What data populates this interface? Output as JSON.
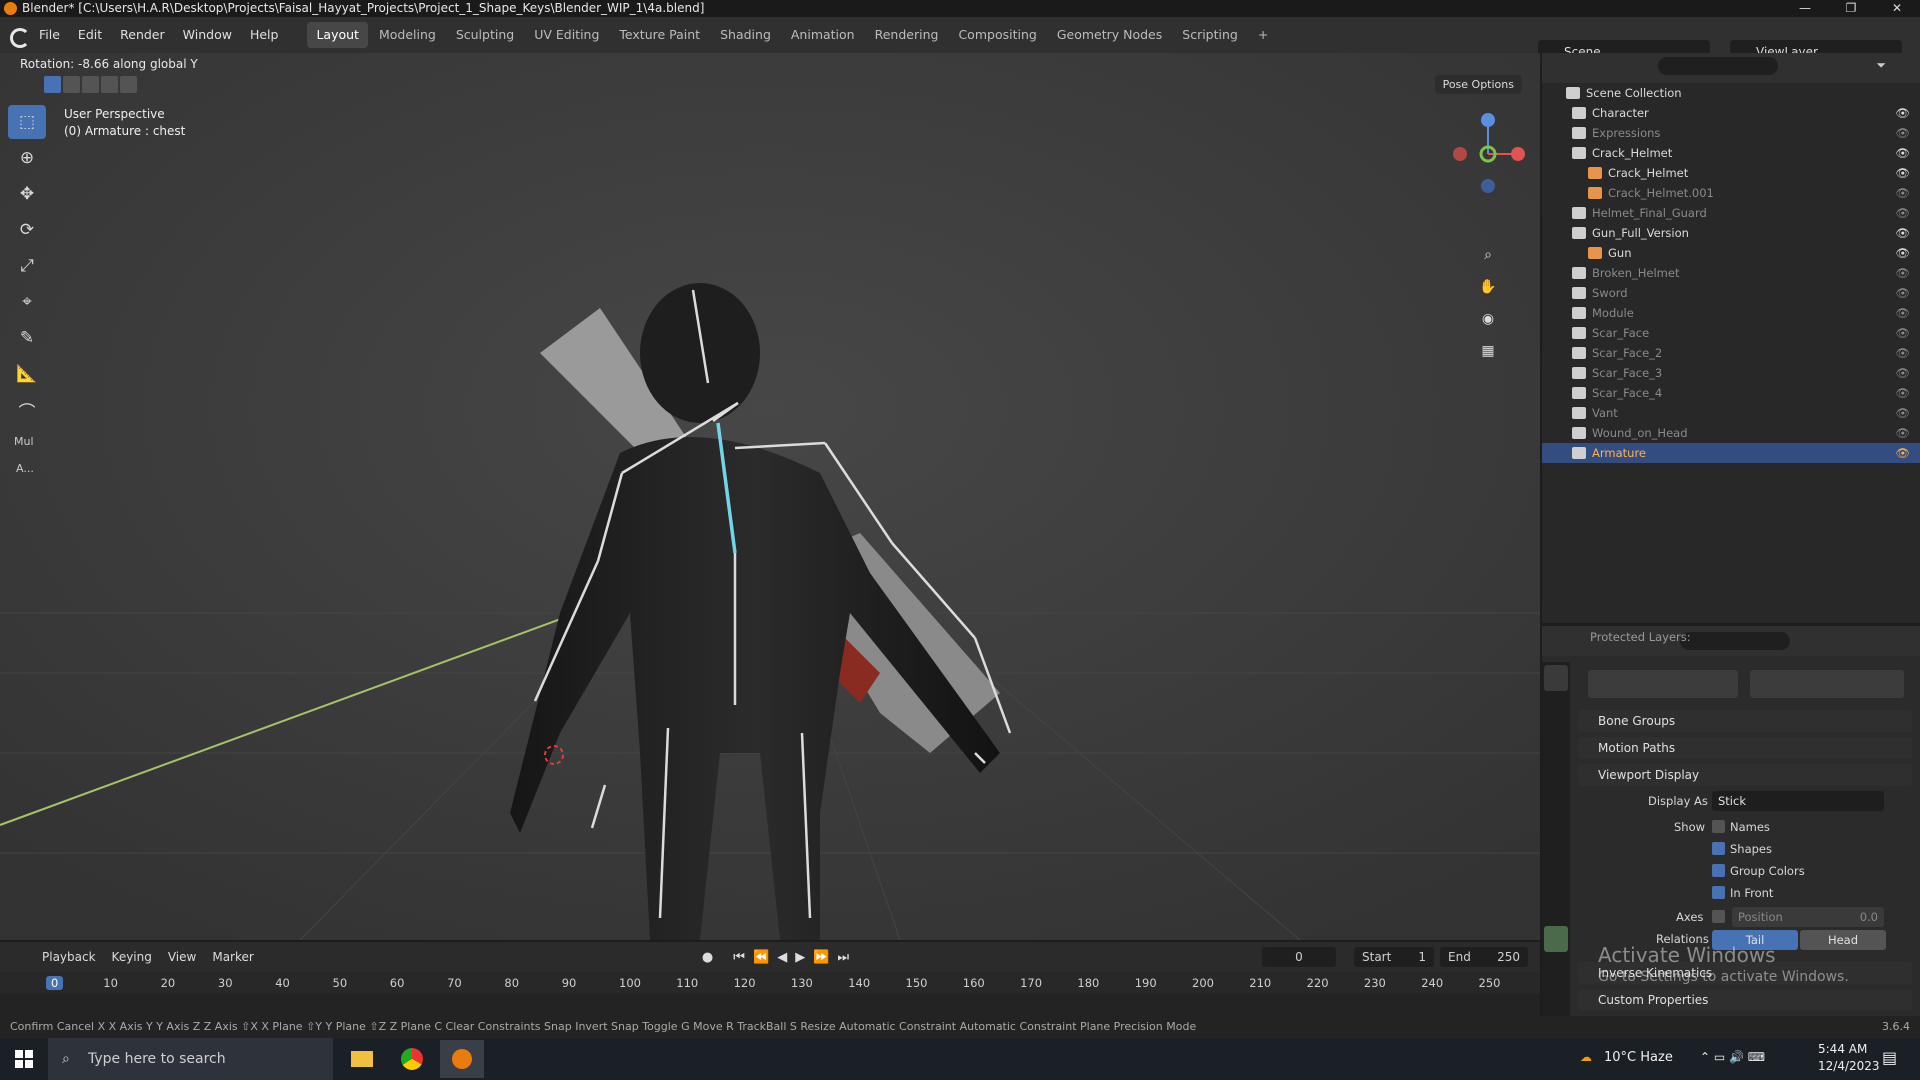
{
  "window": {
    "title": "Blender* [C:\\Users\\H.A.R\\Desktop\\Projects\\Faisal_Hayyat_Projects\\Project_1_Shape_Keys\\Blender_WIP_1\\4a.blend]"
  },
  "menu": [
    "File",
    "Edit",
    "Render",
    "Window",
    "Help"
  ],
  "workspaces": [
    "Layout",
    "Modeling",
    "Sculpting",
    "UV Editing",
    "Texture Paint",
    "Shading",
    "Animation",
    "Rendering",
    "Compositing",
    "Geometry Nodes",
    "Scripting",
    "+"
  ],
  "active_workspace": "Layout",
  "scene": {
    "scene_name": "Scene",
    "view_layer": "ViewLayer"
  },
  "viewport": {
    "operator_status": "Rotation: -8.66 along global Y",
    "view_name": "User Perspective",
    "active_object": "(0) Armature : chest",
    "pose_options": "Pose Options",
    "tools": [
      "select-box",
      "cursor",
      "move",
      "rotate",
      "scale",
      "transform",
      "annotate",
      "measure",
      "bone-envelope"
    ],
    "sidebar_labels": [
      "Mul",
      "A..."
    ],
    "gizmo_axes": {
      "z": "Z",
      "y": "Y",
      "x": "X"
    }
  },
  "outliner": {
    "root": "Scene Collection",
    "items": [
      {
        "name": "Character",
        "level": 1,
        "visible": true,
        "collapsed": true
      },
      {
        "name": "Expressions",
        "level": 1,
        "visible": false
      },
      {
        "name": "Crack_Helmet",
        "level": 1,
        "visible": true,
        "expanded": true
      },
      {
        "name": "Crack_Helmet",
        "level": 2,
        "visible": true,
        "type": "mesh"
      },
      {
        "name": "Crack_Helmet.001",
        "level": 2,
        "visible": false,
        "type": "mesh"
      },
      {
        "name": "Helmet_Final_Guard",
        "level": 1,
        "visible": false
      },
      {
        "name": "Gun_Full_Version",
        "level": 1,
        "visible": true,
        "expanded": true
      },
      {
        "name": "Gun",
        "level": 2,
        "visible": true,
        "type": "mesh"
      },
      {
        "name": "Broken_Helmet",
        "level": 1,
        "visible": false
      },
      {
        "name": "Sword",
        "level": 1,
        "visible": false
      },
      {
        "name": "Module",
        "level": 1,
        "visible": false
      },
      {
        "name": "Scar_Face",
        "level": 1,
        "visible": false
      },
      {
        "name": "Scar_Face_2",
        "level": 1,
        "visible": false
      },
      {
        "name": "Scar_Face_3",
        "level": 1,
        "visible": false
      },
      {
        "name": "Scar_Face_4",
        "level": 1,
        "visible": false
      },
      {
        "name": "Vant",
        "level": 1,
        "visible": false
      },
      {
        "name": "Wound_on_Head",
        "level": 1,
        "visible": false
      },
      {
        "name": "Armature",
        "level": 1,
        "visible": true,
        "selected": true
      }
    ]
  },
  "properties": {
    "protected_layers": "Protected Layers:",
    "sections": [
      "Bone Groups",
      "Motion Paths",
      "Viewport Display",
      "Inverse Kinematics",
      "Custom Properties"
    ],
    "display_as_label": "Display As",
    "display_as_value": "Stick",
    "show_label": "Show",
    "names": "Names",
    "shapes": "Shapes",
    "group_colors": "Group Colors",
    "in_front": "In Front",
    "axes_label": "Axes",
    "axes_position": "Position",
    "axes_value": "0.0",
    "relations_label": "Relations",
    "relations_options": [
      "Tail",
      "Head"
    ],
    "relations_active": "Tail"
  },
  "timeline": {
    "menus": [
      "Playback",
      "Keying",
      "View",
      "Marker"
    ],
    "current_frame": "0",
    "start_label": "Start",
    "start": "1",
    "end_label": "End",
    "end": "250",
    "ruler": [
      "0",
      "10",
      "20",
      "30",
      "40",
      "50",
      "60",
      "70",
      "80",
      "90",
      "100",
      "110",
      "120",
      "130",
      "140",
      "150",
      "160",
      "170",
      "180",
      "190",
      "200",
      "210",
      "220",
      "230",
      "240",
      "250"
    ]
  },
  "statusbar": {
    "hotkeys": "Confirm   Cancel   X X Axis   Y Y Axis   Z Z Axis   ⇧X X Plane   ⇧Y Y Plane   ⇧Z Z Plane   C Clear Constraints   Snap Invert   Snap Toggle   G Move   R TrackBall   S Resize   Automatic Constraint   Automatic Constraint Plane   Precision Mode",
    "version": "3.6.4"
  },
  "activate_windows": {
    "title": "Activate Windows",
    "subtitle": "Go to Settings to activate Windows."
  },
  "taskbar": {
    "search_placeholder": "Type here to search",
    "weather": "10°C  Haze",
    "time": "5:44 AM",
    "date": "12/4/2023"
  },
  "colors": {
    "accent": "#4772b3",
    "selection": "#334d80",
    "active_orange": "#ffb24a",
    "blender_orange": "#e87d0d"
  }
}
